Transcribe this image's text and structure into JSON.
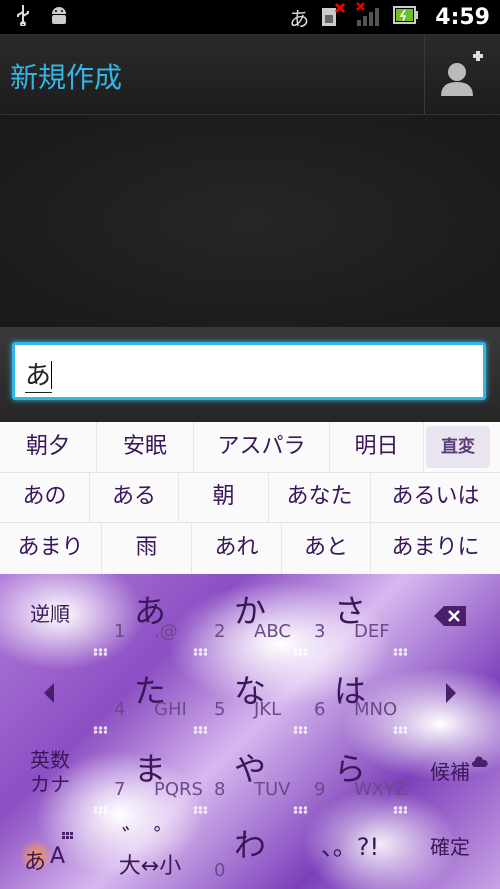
{
  "status_bar": {
    "ime_indicator": "あ",
    "time": "4:59"
  },
  "action_bar": {
    "title": "新規作成"
  },
  "compose": {
    "text": "あ"
  },
  "candidates": {
    "row1": [
      "朝夕",
      "安眠",
      "アスパラ",
      "明日"
    ],
    "convert_label": "直変",
    "row2": [
      "あの",
      "ある",
      "朝",
      "あなた",
      "あるいは"
    ],
    "row3": [
      "あまり",
      "雨",
      "あれ",
      "あと",
      "あまりに"
    ]
  },
  "keyboard": {
    "reverse_label": "逆順",
    "mode_label": "英数\nカナ",
    "mode_label_line1": "英数",
    "mode_label_line2": "カナ",
    "candidates_label": "候補",
    "enter_label": "確定",
    "input_mode_a": "あ",
    "input_mode_b": "A",
    "keys": [
      {
        "kana": "あ",
        "num": "1",
        "roman": ".@"
      },
      {
        "kana": "か",
        "num": "2",
        "roman": "ABC"
      },
      {
        "kana": "さ",
        "num": "3",
        "roman": "DEF"
      },
      {
        "kana": "た",
        "num": "4",
        "roman": "GHI"
      },
      {
        "kana": "な",
        "num": "5",
        "roman": "JKL"
      },
      {
        "kana": "は",
        "num": "6",
        "roman": "MNO"
      },
      {
        "kana": "ま",
        "num": "7",
        "roman": "PQRS"
      },
      {
        "kana": "や",
        "num": "8",
        "roman": "TUV"
      },
      {
        "kana": "ら",
        "num": "9",
        "roman": "WXYZ"
      }
    ],
    "dakuten_top": "゛ ゜",
    "dakuten_bottom": "大↔小",
    "wa_key": {
      "kana": "わ",
      "num": "0"
    },
    "punct_label": "、。?!"
  },
  "colors": {
    "accent": "#33b5e5",
    "key_text": "#3a1758",
    "keyboard_purple": "#8c4fc4"
  }
}
